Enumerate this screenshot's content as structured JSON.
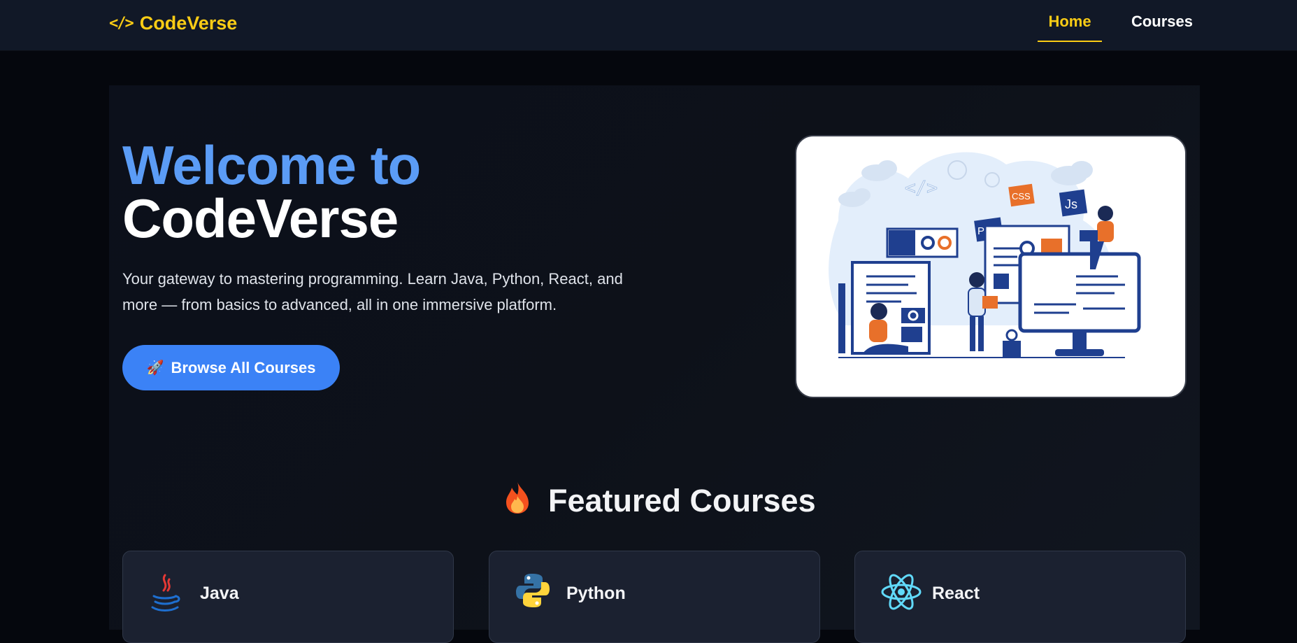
{
  "brand": {
    "name": "CodeVerse",
    "icon": "code-brackets-icon",
    "color": "#facc15"
  },
  "nav": {
    "items": [
      {
        "label": "Home",
        "active": true
      },
      {
        "label": "Courses",
        "active": false
      }
    ]
  },
  "hero": {
    "title_line1": "Welcome to",
    "title_line2": "CodeVerse",
    "description": "Your gateway to mastering programming. Learn Java, Python, React, and more — from basics to advanced, all in one immersive platform.",
    "cta_label": "Browse All Courses",
    "cta_icon": "rocket-icon",
    "illustration": {
      "labels": [
        "</>",
        "CSS",
        "Js",
        "PHP"
      ]
    }
  },
  "featured": {
    "title": "Featured Courses",
    "icon": "fire-icon",
    "courses": [
      {
        "name": "Java",
        "icon": "java-icon"
      },
      {
        "name": "Python",
        "icon": "python-icon"
      },
      {
        "name": "React",
        "icon": "react-icon"
      }
    ]
  },
  "colors": {
    "accent": "#facc15",
    "primary": "#3b82f6",
    "title_blue": "#5b9cf6",
    "background": "#05070d",
    "navbar": "#111827"
  }
}
